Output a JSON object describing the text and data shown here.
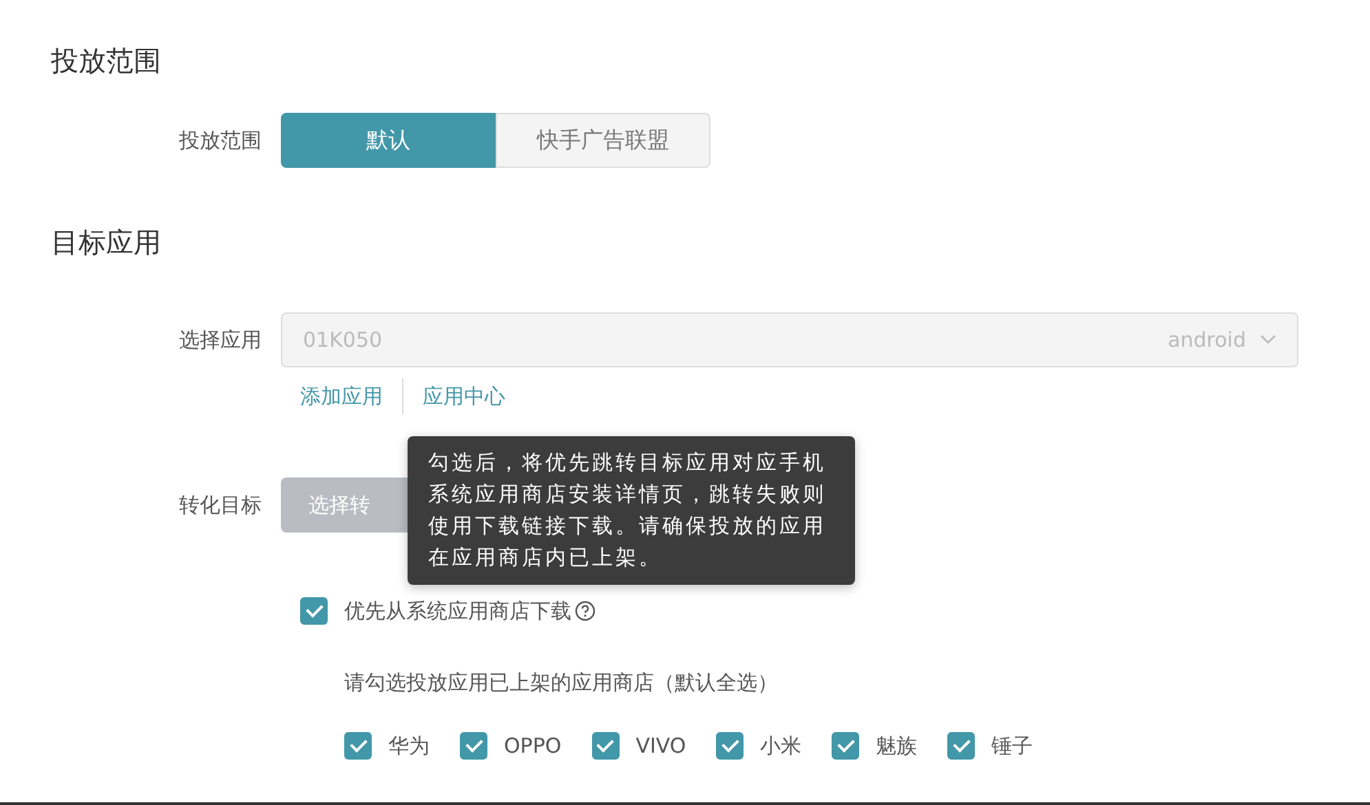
{
  "sections": [
    {
      "title": "投放范围"
    },
    {
      "title": "目标应用"
    }
  ],
  "scope": {
    "label": "投放范围",
    "options": [
      {
        "label": "默认",
        "selected": true
      },
      {
        "label": "快手广告联盟",
        "selected": false
      }
    ]
  },
  "app_select": {
    "label": "选择应用",
    "value": "01K050",
    "platform": "android",
    "disabled": true
  },
  "links": [
    "添加应用",
    "应用中心"
  ],
  "conversion": {
    "label": "转化目标",
    "button": "选择转",
    "disabled": true
  },
  "tooltip": "勾选后，将优先跳转目标应用对应手机系统应用商店安装详情页，跳转失败则使用下载链接下载。请确保投放的应用在应用商店内已上架。",
  "prefer_store": {
    "label": "优先从系统应用商店下载",
    "checked": true
  },
  "store_hint": "请勾选投放应用已上架的应用商店（默认全选）",
  "stores": [
    {
      "label": "华为",
      "checked": true
    },
    {
      "label": "OPPO",
      "checked": true
    },
    {
      "label": "VIVO",
      "checked": true
    },
    {
      "label": "小米",
      "checked": true
    },
    {
      "label": "魅族",
      "checked": true
    },
    {
      "label": "锤子",
      "checked": true
    }
  ]
}
